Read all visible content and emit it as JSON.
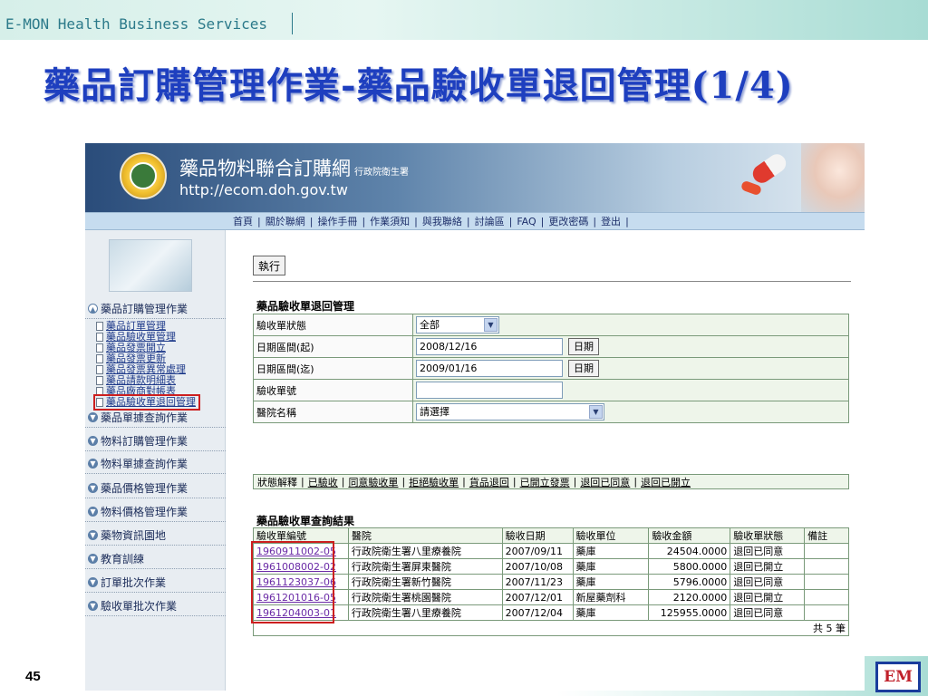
{
  "slide": {
    "header_text": "E-MON Health Business Services",
    "title": "藥品訂購管理作業-藥品驗收單退回管理(1/4)",
    "page_number": "45",
    "logo_text": "EM"
  },
  "site": {
    "title": "藥品物料聯合訂購網",
    "subtitle": "行政院衛生署",
    "url": "http://ecom.doh.gov.tw"
  },
  "nav": {
    "items": [
      "首頁",
      "關於聯網",
      "操作手冊",
      "作業須知",
      "與我聯絡",
      "討論區",
      "FAQ",
      "更改密碼",
      "登出"
    ],
    "separator": "|"
  },
  "sidebar": {
    "open_category": "藥品訂購管理作業",
    "sub_items": [
      "藥品訂單管理",
      "藥品驗收單管理",
      "藥品發票開立",
      "藥品發票更新",
      "藥品發票異常處理",
      "藥品請款明細表",
      "藥品廠商對帳表",
      "藥品驗收單退回管理"
    ],
    "categories": [
      "藥品單據查詢作業",
      "物料訂購管理作業",
      "物料單據查詢作業",
      "藥品價格管理作業",
      "物料價格管理作業",
      "藥物資訊園地",
      "教育訓練",
      "訂單批次作業",
      "驗收單批次作業"
    ]
  },
  "form": {
    "execute_label": "執行",
    "section_title": "藥品驗收單退回管理",
    "status_label": "驗收單狀態",
    "status_value": "全部",
    "date_start_label": "日期區間(起)",
    "date_start_value": "2008/12/16",
    "date_end_label": "日期區間(迄)",
    "date_end_value": "2009/01/16",
    "date_button": "日期",
    "receipt_no_label": "驗收單號",
    "receipt_no_value": "",
    "hospital_label": "醫院名稱",
    "hospital_value": "請選擇"
  },
  "legend": {
    "label": "狀態解釋",
    "links": [
      "已驗收",
      "同意驗收單",
      "拒絕驗收單",
      "貨品退回",
      "已開立發票",
      "退回已同意",
      "退回已開立"
    ]
  },
  "results": {
    "section_title": "藥品驗收單查詢結果",
    "headers": [
      "驗收單編號",
      "醫院",
      "驗收日期",
      "驗收單位",
      "驗收金額",
      "驗收單狀態",
      "備註"
    ],
    "rows": [
      {
        "id": "1960911002-05",
        "hospital": "行政院衛生署八里療養院",
        "date": "2007/09/11",
        "unit": "藥庫",
        "amount": "24504.0000",
        "status": "退回已同意",
        "note": ""
      },
      {
        "id": "1961008002-02",
        "hospital": "行政院衛生署屏東醫院",
        "date": "2007/10/08",
        "unit": "藥庫",
        "amount": "5800.0000",
        "status": "退回已開立",
        "note": ""
      },
      {
        "id": "1961123037-06",
        "hospital": "行政院衛生署新竹醫院",
        "date": "2007/11/23",
        "unit": "藥庫",
        "amount": "5796.0000",
        "status": "退回已同意",
        "note": ""
      },
      {
        "id": "1961201016-05",
        "hospital": "行政院衛生署桃園醫院",
        "date": "2007/12/01",
        "unit": "新屋藥劑科",
        "amount": "2120.0000",
        "status": "退回已開立",
        "note": ""
      },
      {
        "id": "1961204003-01",
        "hospital": "行政院衛生署八里療養院",
        "date": "2007/12/04",
        "unit": "藥庫",
        "amount": "125955.0000",
        "status": "退回已同意",
        "note": ""
      }
    ],
    "total_text": "共 5 筆"
  }
}
